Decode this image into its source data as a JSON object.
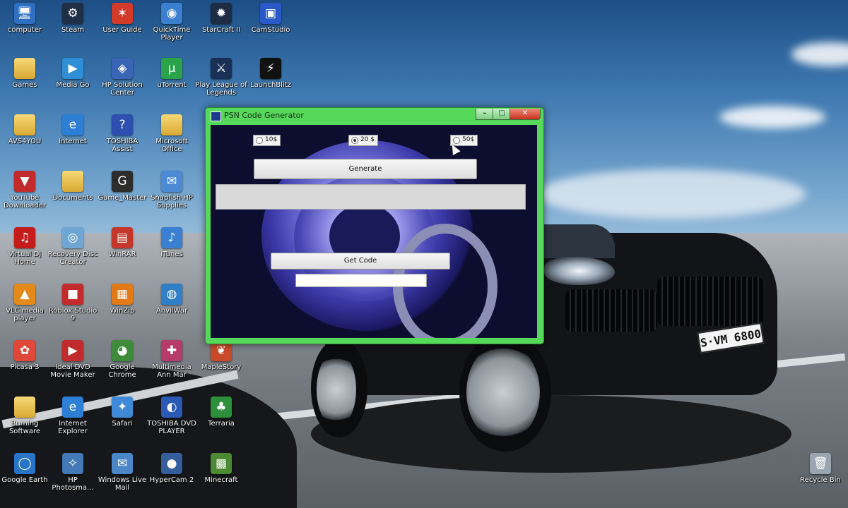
{
  "desktop": {
    "icons": [
      {
        "label": "computer",
        "glyph": "🖥"
      },
      {
        "label": "Steam",
        "glyph": "⚙"
      },
      {
        "label": "User Guide",
        "glyph": "✶"
      },
      {
        "label": "QuickTime Player",
        "glyph": "◉"
      },
      {
        "label": "StarCraft II",
        "glyph": "✹"
      },
      {
        "label": "CamStudio",
        "glyph": "▣"
      },
      {
        "label": "Games",
        "glyph": ""
      },
      {
        "label": "Media Go",
        "glyph": "▶"
      },
      {
        "label": "HP Solution Center",
        "glyph": "◈"
      },
      {
        "label": "uTorrent",
        "glyph": "µ"
      },
      {
        "label": "Play League of Legends",
        "glyph": "⚔"
      },
      {
        "label": "LaunchBlitz",
        "glyph": "⚡"
      },
      {
        "label": "AVS4YOU",
        "glyph": ""
      },
      {
        "label": "Internet",
        "glyph": "e"
      },
      {
        "label": "TOSHIBA Assist",
        "glyph": "?"
      },
      {
        "label": "Microsoft Office",
        "glyph": ""
      },
      {
        "label": "YouTube Downloader",
        "glyph": "▼"
      },
      {
        "label": "Documents",
        "glyph": ""
      },
      {
        "label": "Game_Master",
        "glyph": "G"
      },
      {
        "label": "Snapfish HP Supplies",
        "glyph": "✉"
      },
      {
        "label": "Virtual DJ Home",
        "glyph": "♫"
      },
      {
        "label": "Recovery Disc Creator",
        "glyph": "◎"
      },
      {
        "label": "WinRAR",
        "glyph": "▤"
      },
      {
        "label": "iTunes",
        "glyph": "♪"
      },
      {
        "label": "VLC media player",
        "glyph": "▲"
      },
      {
        "label": "Roblox Studio 9",
        "glyph": "■"
      },
      {
        "label": "WinZip",
        "glyph": "▦"
      },
      {
        "label": "AnvilWar",
        "glyph": "◍"
      },
      {
        "label": "Picasa 3",
        "glyph": "✿"
      },
      {
        "label": "Ideal DVD Movie Maker",
        "glyph": "▶"
      },
      {
        "label": "Google Chrome",
        "glyph": "◕"
      },
      {
        "label": "Multimedia Ann Mar",
        "glyph": "✚"
      },
      {
        "label": "MapleStory",
        "glyph": "❦"
      },
      {
        "label": "Burning Software",
        "glyph": ""
      },
      {
        "label": "Internet Explorer",
        "glyph": "e"
      },
      {
        "label": "Safari",
        "glyph": "✦"
      },
      {
        "label": "TOSHIBA DVD PLAYER",
        "glyph": "◐"
      },
      {
        "label": "Terraria",
        "glyph": "♣"
      },
      {
        "label": "Google Earth",
        "glyph": "◯"
      },
      {
        "label": "HP Photosma...",
        "glyph": "✧"
      },
      {
        "label": "Windows Live Mail",
        "glyph": "✉"
      },
      {
        "label": "HyperCam 2",
        "glyph": "●"
      },
      {
        "label": "Minecraft",
        "glyph": "▩"
      },
      {
        "label": "Recycle Bin",
        "glyph": "🗑"
      }
    ],
    "plate_text": "S·VM 6800"
  },
  "window": {
    "title": "PSN Code Generator",
    "minimize_symbol": "–",
    "maximize_symbol": "□",
    "close_symbol": "✕",
    "options": [
      {
        "label": "10$",
        "checked": false
      },
      {
        "label": "20 $",
        "checked": true
      },
      {
        "label": "50$",
        "checked": false
      }
    ],
    "generate_label": "Generate",
    "generated_code_value": "",
    "get_code_label": "Get Code",
    "code_output_value": ""
  },
  "colors": {
    "window_frame": "#56d95a",
    "client_background": "#0d0d30"
  }
}
